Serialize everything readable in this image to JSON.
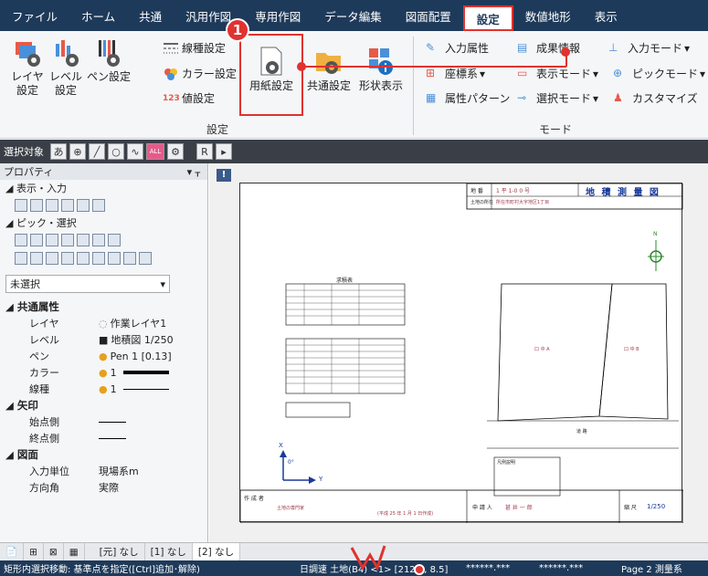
{
  "menu": [
    "ファイル",
    "ホーム",
    "共通",
    "汎用作図",
    "専用作図",
    "データ編集",
    "図面配置",
    "設定",
    "数値地形",
    "表示"
  ],
  "callout_number": "1",
  "ribbon": {
    "settings_group": {
      "label": "設定",
      "layer": "レイヤ\n設定",
      "level": "レベル\n設定",
      "pen": "ペン設定",
      "linetype": "線種設定",
      "color": "カラー設定",
      "value": "値設定",
      "paper": "用紙設定",
      "common": "共通設定",
      "shape": "形状表示"
    },
    "mode_group": {
      "label": "モード",
      "input_attr": "入力属性",
      "result_info": "成果情報",
      "input_mode": "入力モード",
      "coord_sys": "座標系",
      "display_mode": "表示モード",
      "pick_mode": "ピックモード",
      "attr_pattern": "属性パターン",
      "select_mode": "選択モード",
      "customize": "カスタマイズ"
    }
  },
  "sel_toolbar": {
    "label": "選択対象",
    "a": "あ",
    "all": "ALL",
    "r": "R"
  },
  "sidebar": {
    "title": "プロパティ",
    "pin": "▾ ᚁ",
    "display_input": "表示・入力",
    "pick_select": "ピック・選択",
    "unselected": "未選択",
    "common_attr": "共通属性",
    "arrow": "矢印",
    "drawing": "図面",
    "props": [
      {
        "k": "レイヤ",
        "v": "作業レイヤ1"
      },
      {
        "k": "レベル",
        "v": "地積図 1/250"
      },
      {
        "k": "ペン",
        "v": "Pen 1 [0.13]"
      },
      {
        "k": "カラー",
        "v": "1"
      },
      {
        "k": "線種",
        "v": "1"
      }
    ],
    "arrow_props": [
      {
        "k": "始点側",
        "v": ""
      },
      {
        "k": "終点側",
        "v": ""
      }
    ],
    "drawing_props": [
      {
        "k": "入力単位",
        "v": "現場系m"
      },
      {
        "k": "方向角",
        "v": "実際"
      }
    ]
  },
  "paper": {
    "title": "地 積 測 量 図",
    "chiban_label": "地 番",
    "chiban_val": "1 平 1-0 0 号",
    "location_label": "土地の所在",
    "location_val": "所在市町村大字地区1丁目",
    "table1_title": "求積表",
    "north": "N",
    "road": "道 路",
    "lot_a": "口 中 A",
    "lot_b": "口 中 B",
    "author_label": "作 成 者",
    "author_val": "土地の専門家",
    "applicant_label": "申 請 人",
    "applicant_val": "甚 井 一 郎",
    "scale_label": "縮 尺",
    "scale_val": "1/250",
    "axis_x": "X",
    "axis_y": "Y",
    "angle": "0°",
    "date": "(平成 25 年 1 月 1 日作成)",
    "legend_title": "凡例説明"
  },
  "bottom_tabs": [
    "[元] なし",
    "[1] なし",
    "[2] なし"
  ],
  "status": {
    "left": "矩形内選択移動: 基準点を指定([Ctrl]追加･解除)",
    "mid": "日調速 土地(B4) <1> [212.5, 8.5]",
    "s1": "******.***",
    "s2": "******.***",
    "page": "Page 2 測量系"
  },
  "colors": {
    "menubar": "#1e3a5a",
    "highlight": "#e0322f"
  }
}
